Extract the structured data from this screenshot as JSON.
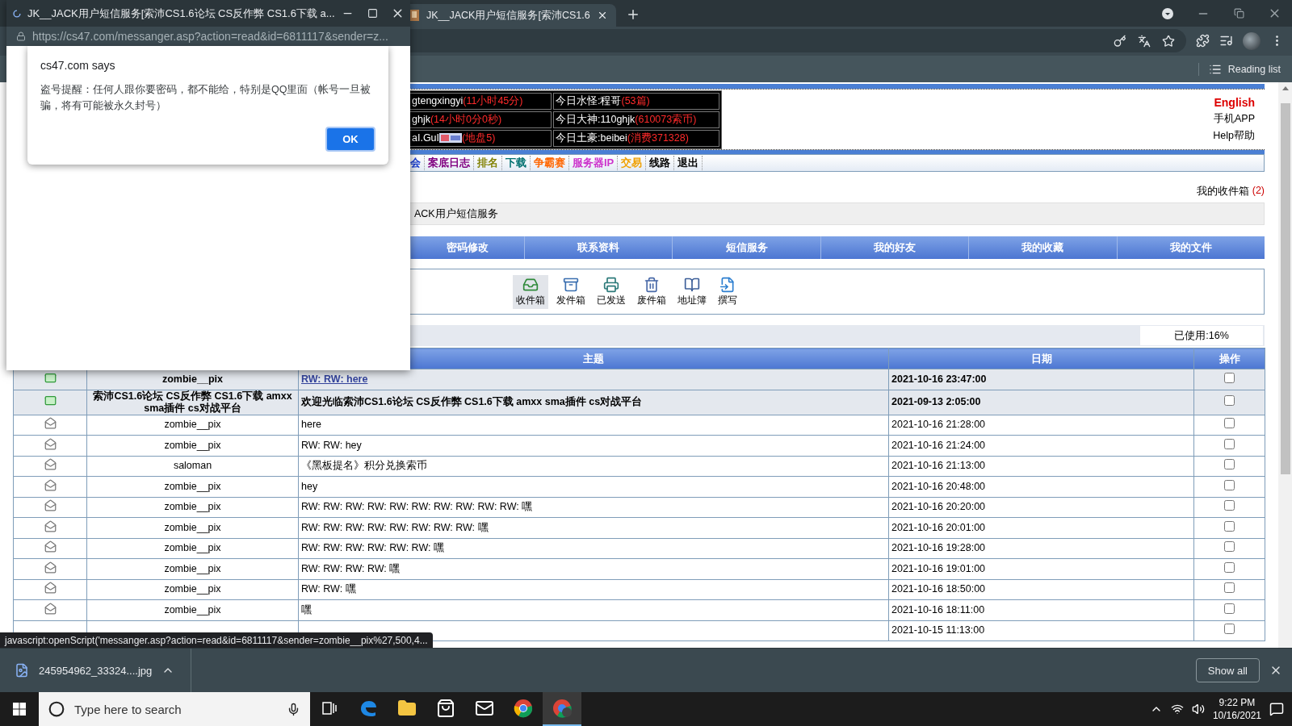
{
  "popup_window": {
    "title": "JK__JACK用户短信服务[索沛CS1.6论坛 CS反作弊 CS1.6下载 a...",
    "url": "https://cs47.com/messanger.asp?action=read&id=6811117&sender=z...",
    "dialog": {
      "heading": "cs47.com says",
      "message": "盗号提醒：任何人跟你要密码，都不能给，特别是QQ里面（帐号一旦被骗，将有可能被永久封号）",
      "button": "OK"
    }
  },
  "browser": {
    "tabs": [
      {
        "title": "JK__JACK用户短信服务[索沛CS1.6",
        "selected": true
      }
    ],
    "bookmarks": [
      "Reading list"
    ]
  },
  "header": {
    "stats": [
      [
        {
          "name": "gtengxingyi",
          "note": "(11小时45分)"
        },
        {
          "name": "今日水怪:程哥",
          "note": "(53篇)"
        }
      ],
      [
        {
          "name": "ghjk",
          "note": "(14小时0分0秒)"
        },
        {
          "name": "今日大神:110ghjk",
          "note": "(610073索币)"
        }
      ],
      [
        {
          "name": "aI.GuI",
          "note": "(地盘5)",
          "image": true
        },
        {
          "name": "今日土豪:beibei",
          "note": "(消费371328)"
        }
      ]
    ],
    "links": [
      {
        "label": "English",
        "kind": "language"
      },
      {
        "label": "手机APP",
        "kind": "plain"
      },
      {
        "label": "Help帮助",
        "kind": "plain"
      }
    ]
  },
  "nav": [
    {
      "label": "会",
      "color": "#1a3fd0"
    },
    {
      "label": "案底日志",
      "color": "#800080"
    },
    {
      "label": "排名",
      "color": "#808000"
    },
    {
      "label": "下载",
      "color": "#007070"
    },
    {
      "label": "争霸赛",
      "color": "#ff6600"
    },
    {
      "label": "服务器IP",
      "color": "#cc33cc"
    },
    {
      "label": "交易",
      "color": "#f0a000"
    },
    {
      "label": "线路",
      "color": "#000000"
    },
    {
      "label": "退出",
      "color": "#000000"
    }
  ],
  "inbox": {
    "label": "我的收件箱",
    "count": "(2)"
  },
  "breadcrumb": "ACK用户短信服务",
  "sections": [
    "密码修改",
    "联系资料",
    "短信服务",
    "我的好友",
    "我的收藏",
    "我的文件"
  ],
  "folders": [
    {
      "label": "收件箱",
      "kind": "inbox",
      "selected": true
    },
    {
      "label": "发件箱",
      "kind": "outbox",
      "selected": false
    },
    {
      "label": "已发送",
      "kind": "sent",
      "selected": false
    },
    {
      "label": "废件箱",
      "kind": "trash",
      "selected": false
    },
    {
      "label": "地址簿",
      "kind": "contacts",
      "selected": false
    },
    {
      "label": "撰写",
      "kind": "compose",
      "selected": false
    }
  ],
  "usage": "已使用:16%",
  "table": {
    "columns": [
      "主题",
      "日期",
      "操作"
    ],
    "rows": [
      {
        "unread": true,
        "hovered": true,
        "sender": "zombie__pix",
        "subject": "RW: RW: here",
        "date": "2021-10-16 23:47:00",
        "checked": false
      },
      {
        "unread": true,
        "hovered": false,
        "sender": "索沛CS1.6论坛 CS反作弊 CS1.6下载 amxx sma插件 cs对战平台",
        "subject": "欢迎光临索沛CS1.6论坛 CS反作弊 CS1.6下载 amxx sma插件 cs对战平台",
        "date": "2021-09-13 2:05:00",
        "checked": false
      },
      {
        "unread": false,
        "hovered": false,
        "sender": "zombie__pix",
        "subject": "here",
        "date": "2021-10-16 21:28:00",
        "checked": false
      },
      {
        "unread": false,
        "hovered": false,
        "sender": "zombie__pix",
        "subject": "RW: RW: hey",
        "date": "2021-10-16 21:24:00",
        "checked": false
      },
      {
        "unread": false,
        "hovered": false,
        "sender": "saloman",
        "subject": "《黑板提名》积分兑换索币",
        "date": "2021-10-16 21:13:00",
        "checked": false
      },
      {
        "unread": false,
        "hovered": false,
        "sender": "zombie__pix",
        "subject": "hey",
        "date": "2021-10-16 20:48:00",
        "checked": false
      },
      {
        "unread": false,
        "hovered": false,
        "sender": "zombie__pix",
        "subject": "RW: RW: RW: RW: RW: RW: RW: RW: RW: RW: 嘿",
        "date": "2021-10-16 20:20:00",
        "checked": false
      },
      {
        "unread": false,
        "hovered": false,
        "sender": "zombie__pix",
        "subject": "RW: RW: RW: RW: RW: RW: RW: RW: 嘿",
        "date": "2021-10-16 20:01:00",
        "checked": false
      },
      {
        "unread": false,
        "hovered": false,
        "sender": "zombie__pix",
        "subject": "RW: RW: RW: RW: RW: RW: 嘿",
        "date": "2021-10-16 19:28:00",
        "checked": false
      },
      {
        "unread": false,
        "hovered": false,
        "sender": "zombie__pix",
        "subject": "RW: RW: RW: RW: 嘿",
        "date": "2021-10-16 19:01:00",
        "checked": false
      },
      {
        "unread": false,
        "hovered": false,
        "sender": "zombie__pix",
        "subject": "RW: RW: 嘿",
        "date": "2021-10-16 18:50:00",
        "checked": false
      },
      {
        "unread": false,
        "hovered": false,
        "sender": "zombie__pix",
        "subject": "嘿",
        "date": "2021-10-16 18:11:00",
        "checked": false
      },
      {
        "date": "2021-10-15 11:13:00",
        "checked": false
      }
    ]
  },
  "status_bar": "javascript:openScript('messanger.asp?action=read&id=6811117&sender=zombie__pix%27,500,4...",
  "downloads": {
    "file": "245954962_33324....jpg",
    "show_all": "Show all"
  },
  "taskbar": {
    "search": {
      "placeholder": "Type here to search"
    },
    "apps": [
      {
        "kind": "taskview",
        "active": false
      },
      {
        "kind": "edge",
        "active": false
      },
      {
        "kind": "explorer",
        "active": false
      },
      {
        "kind": "store",
        "active": false
      },
      {
        "kind": "mail",
        "active": false
      },
      {
        "kind": "chrome",
        "active": false
      },
      {
        "kind": "chrome-profile",
        "active": true
      }
    ],
    "time": "9:22 PM",
    "date": "10/16/2021"
  }
}
